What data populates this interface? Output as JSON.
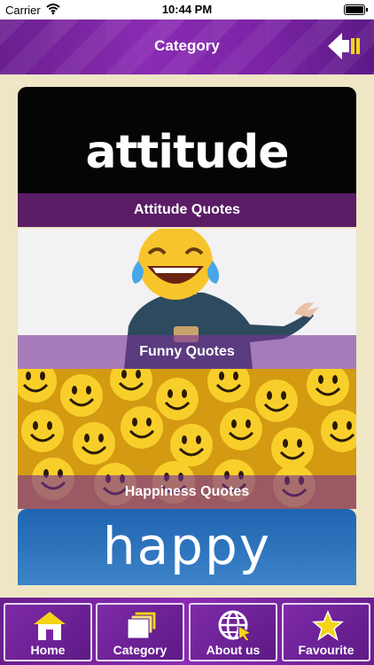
{
  "status_bar": {
    "carrier": "Carrier",
    "time": "10:44 PM"
  },
  "nav": {
    "title": "Category",
    "back_icon": "back-arrow-icon"
  },
  "categories": [
    {
      "label": "Attitude Quotes",
      "image_text": "attitude"
    },
    {
      "label": "Funny Quotes",
      "image_text": ""
    },
    {
      "label": "Happiness Quotes",
      "image_text": ""
    },
    {
      "label": "",
      "image_text": "happy"
    }
  ],
  "tabs": [
    {
      "label": "Home",
      "icon": "home-icon"
    },
    {
      "label": "Category",
      "icon": "category-icon"
    },
    {
      "label": "About us",
      "icon": "globe-cursor-icon"
    },
    {
      "label": "Favourite",
      "icon": "star-icon"
    }
  ],
  "colors": {
    "primary_purple": "#7b23a6",
    "background": "#efe6c6",
    "accent_yellow": "#f5d415"
  }
}
